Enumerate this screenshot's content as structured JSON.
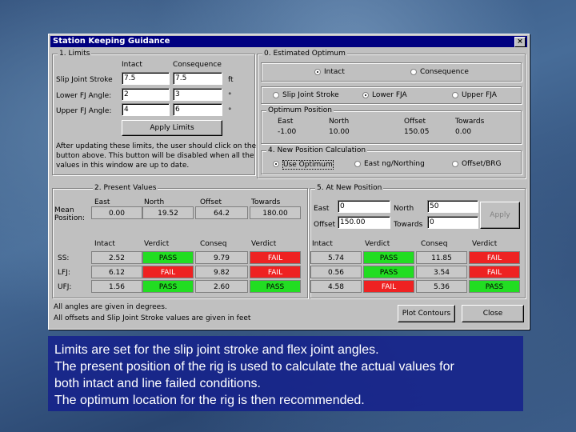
{
  "window": {
    "title": "Station Keeping Guidance",
    "close_glyph": "×"
  },
  "limits": {
    "group_title": "1. Limits",
    "col_intact": "Intact",
    "col_consequence": "Consequence",
    "rows": [
      {
        "label": "Slip Joint Stroke",
        "intact": "7.5",
        "consequence": "7.5",
        "unit": "ft"
      },
      {
        "label": "Lower FJ Angle:",
        "intact": "2",
        "consequence": "3",
        "unit": "°"
      },
      {
        "label": "Upper FJ Angle:",
        "intact": "4",
        "consequence": "6",
        "unit": "°"
      }
    ],
    "apply_label": "Apply Limits",
    "note1": "After updating these limits, the user should click on the",
    "note2": "button above. This button will be disabled when all the",
    "note3": "values in this window are up to date."
  },
  "optimum": {
    "group_title": "0. Estimated Optimum",
    "opt_intact": "Intact",
    "opt_consequence": "Consequence",
    "opt_slip": "Slip Joint Stroke",
    "opt_lower": "Lower FJA",
    "opt_upper": "Upper FJA",
    "position_title": "Optimum Position",
    "pos_headers": [
      "East",
      "North",
      "Offset",
      "Towards"
    ],
    "pos_values": [
      "-1.00",
      "10.00",
      "150.05",
      "0.00"
    ],
    "calc_title": "4. New Position Calculation",
    "calc_use": "Use Optimum",
    "calc_east": "East ng/Northing",
    "calc_offset": "Offset/BRG"
  },
  "present": {
    "group_title": "2. Present Values",
    "headers": [
      "East",
      "North",
      "Offset",
      "Towards"
    ],
    "mean_label1": "Mean",
    "mean_label2": "Position:",
    "mean_values": [
      "0.00",
      "19.52",
      "64.2",
      "180.00"
    ],
    "col_heads": [
      "Intact",
      "Verdict",
      "Conseq",
      "Verdict"
    ],
    "rows": [
      {
        "label": "SS:",
        "intact": "2.52",
        "v1": "PASS",
        "conseq": "9.79",
        "v2": "FAIL"
      },
      {
        "label": "LFJ:",
        "intact": "6.12",
        "v1": "FAIL",
        "conseq": "9.82",
        "v2": "FAIL"
      },
      {
        "label": "UFJ:",
        "intact": "1.56",
        "v1": "PASS",
        "conseq": "2.60",
        "v2": "PASS"
      }
    ]
  },
  "newpos": {
    "group_title": "5. At New Position",
    "east_label": "East",
    "east_value": "0",
    "north_label": "North",
    "north_value": "50",
    "offset_label": "Offset",
    "offset_value": "150.00",
    "towards_label": "Towards",
    "towards_value": "0",
    "apply_label": "Apply",
    "col_heads": [
      "Intact",
      "Verdict",
      "Conseq",
      "Verdict"
    ],
    "rows": [
      {
        "intact": "5.74",
        "v1": "PASS",
        "conseq": "11.85",
        "v2": "FAIL"
      },
      {
        "intact": "0.56",
        "v1": "PASS",
        "conseq": "3.54",
        "v2": "FAIL"
      },
      {
        "intact": "4.58",
        "v1": "FAIL",
        "conseq": "5.36",
        "v2": "PASS"
      }
    ]
  },
  "footer": {
    "note1": "All angles are given in degrees.",
    "note2": "All offsets and Slip Joint Stroke values are given in feet",
    "plot_label": "Plot Contours",
    "close_label": "Close"
  },
  "caption": {
    "line1": "Limits are set for the slip joint stroke and flex joint angles.",
    "line2": "The present position of the rig is used to calculate the actual values for",
    "line3": "both intact and line failed conditions.",
    "line4": "The optimum location for the rig is then recommended."
  },
  "colors": {
    "pass": "#22dd22",
    "fail": "#ee2222",
    "titlebar": "#000080"
  }
}
